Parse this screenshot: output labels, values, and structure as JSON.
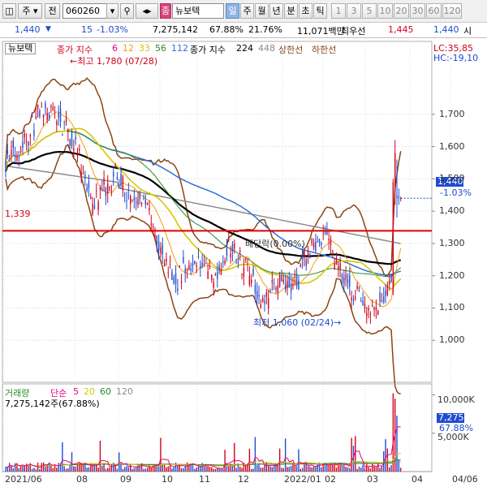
{
  "toolbar": {
    "win_icon": "◫",
    "mode1": "주",
    "mode2": "전",
    "code": "060260",
    "stock_badge": "종",
    "stock_name": "뉴보텍",
    "period_tabs": [
      "일",
      "주",
      "월",
      "년",
      "분",
      "초",
      "틱"
    ],
    "active_period": "일",
    "num_tabs": [
      "1",
      "3",
      "5",
      "10",
      "20",
      "30",
      "60",
      "120"
    ]
  },
  "quote": {
    "price": "1,440",
    "change": "15",
    "change_pct": "-1.03%",
    "volume": "7,275,142",
    "volume_ratio": "67.88%",
    "turnover": "21.76%",
    "amount": "11,071백만",
    "pref_label": "최우선",
    "ask": "1,445",
    "bid": "1,440",
    "tail": "시"
  },
  "price_panel": {
    "stock_label": "뉴보텍",
    "legend_title": "종가 지수",
    "ma": [
      {
        "label": "6",
        "color": "#e8007e"
      },
      {
        "label": "12",
        "color": "#f39c12"
      },
      {
        "label": "33",
        "color": "#d4c800"
      },
      {
        "label": "56",
        "color": "#2a8a2a"
      },
      {
        "label": "112",
        "color": "#2f6fd6"
      }
    ],
    "legend_title2": "종가 지수",
    "ma_extra": [
      {
        "label": "224",
        "color": "#000000"
      },
      {
        "label": "448",
        "color": "#8c8c8c"
      }
    ],
    "upper_band": "상한선",
    "lower_band": "하한선",
    "lc": "LC:35,85",
    "hc": "HC:-19,10",
    "high_note": "최고 1,780 (07/28)",
    "low_note": "최저 1,060 (02/24)",
    "ex_div_note": "배당락(0.00%)",
    "ref_level": "1,339",
    "current_price": "1,440",
    "current_pct": "-1.03%",
    "y_labels": [
      "1,700",
      "1,600",
      "1,500",
      "1,400",
      "1,300",
      "1,200",
      "1,100",
      "1,000"
    ]
  },
  "volume_panel": {
    "title": "거래량",
    "ma_title": "단순",
    "ma": [
      {
        "label": "5",
        "color": "#e8007e"
      },
      {
        "label": "20",
        "color": "#d4c800"
      },
      {
        "label": "60",
        "color": "#2a8a2a"
      },
      {
        "label": "120",
        "color": "#8c8c8c"
      }
    ],
    "summary": "7,275,142주(67.88%)",
    "y_label": "10,000K",
    "y_label2": "5,000K",
    "current": "7,275K",
    "current_pct": "67.88%"
  },
  "x_axis": [
    "2021/06",
    "08",
    "09",
    "10",
    "11",
    "12",
    "2022/01",
    "02",
    "03",
    "04",
    "04/06"
  ],
  "chart_data": {
    "type": "candlestick",
    "ylim": [
      880,
      1780
    ],
    "high": {
      "value": 1780,
      "date": "07/28"
    },
    "low": {
      "value": 1060,
      "date": "02/24"
    },
    "reference_line": 1339,
    "last_close": 1440,
    "last_change_pct": -1.03,
    "volume_last": 7275142,
    "volume_ylim": [
      0,
      11000000
    ]
  }
}
